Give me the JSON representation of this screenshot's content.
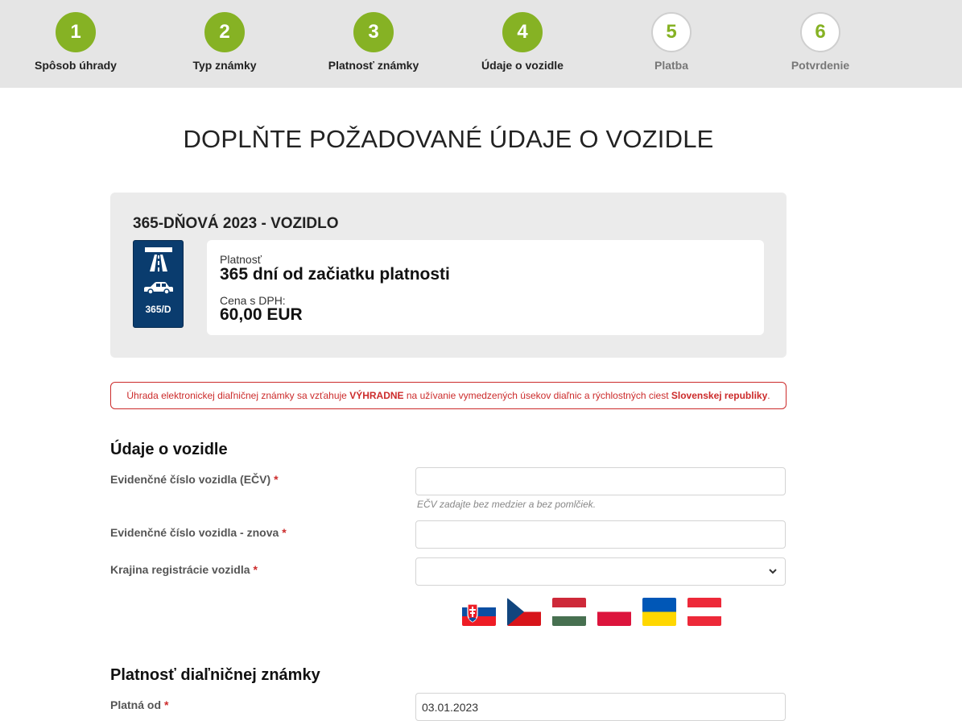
{
  "stepper": {
    "steps": [
      {
        "num": "1",
        "label": "Spôsob úhrady",
        "state": "done"
      },
      {
        "num": "2",
        "label": "Typ známky",
        "state": "done"
      },
      {
        "num": "3",
        "label": "Platnosť známky",
        "state": "done"
      },
      {
        "num": "4",
        "label": "Údaje o vozidle",
        "state": "done"
      },
      {
        "num": "5",
        "label": "Platba",
        "state": "todo"
      },
      {
        "num": "6",
        "label": "Potvrdenie",
        "state": "todo"
      }
    ],
    "accent": "#86b224"
  },
  "page_title": "DOPLŇTE POŽADOVANÉ ÚDAJE O VOZIDLE",
  "product": {
    "title": "365-DŇOVÁ 2023 - VOZIDLO",
    "sticker_code": "365/D",
    "sticker_icons": [
      "highway-icon",
      "car-icon"
    ],
    "validity_label": "Platnosť",
    "validity_value": "365 dní od začiatku platnosti",
    "price_label": "Cena s DPH:",
    "price_value": "60,00 EUR"
  },
  "notice": {
    "part1": "Úhrada elektronickej diaľničnej známky sa vzťahuje ",
    "bold1": "VÝHRADNE",
    "part2": " na užívanie vymedzených úsekov diaľnic a rýchlostných ciest ",
    "bold2": "Slovenskej republiky",
    "part3": ".",
    "color": "#cc2b2b"
  },
  "vehicle_section": {
    "title": "Údaje o vozidle",
    "ecv_label": "Evidenčné číslo vozidla (EČV)",
    "ecv_value": "",
    "ecv_hint": "EČV zadajte bez medzier a bez pomlčiek.",
    "ecv_repeat_label": "Evidenčné číslo vozidla - znova",
    "ecv_repeat_value": "",
    "country_label": "Krajina registrácie vozidla",
    "country_value": "",
    "required_mark": "*",
    "flags": [
      "flag-slovakia",
      "flag-czech-republic",
      "flag-hungary",
      "flag-poland",
      "flag-ukraine",
      "flag-austria"
    ]
  },
  "validity_section": {
    "title": "Platnosť diaľničnej známky",
    "valid_from_label": "Platná od",
    "valid_from_value": "03.01.2023"
  }
}
